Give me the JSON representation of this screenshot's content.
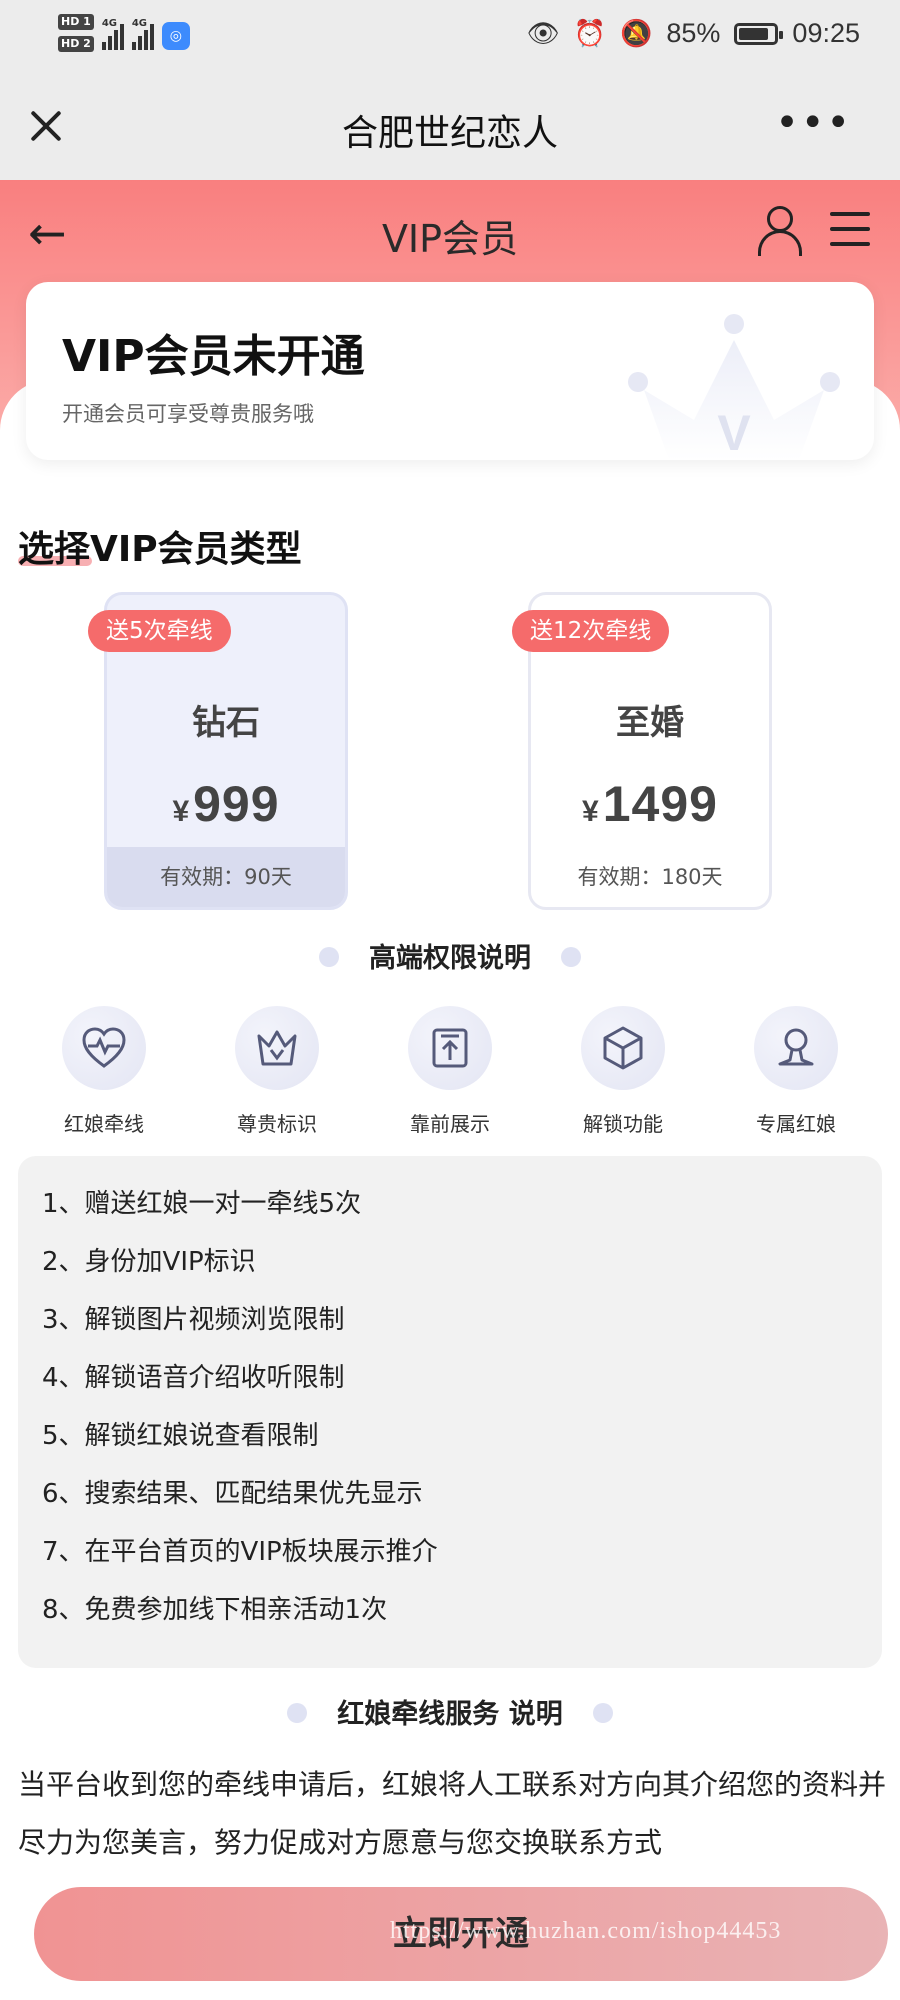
{
  "status_bar": {
    "sim1": "HD 1",
    "sim2": "HD 2",
    "net1": "4G",
    "net2": "4G",
    "battery": "85%",
    "battery_level": 0.85,
    "time": "09:25"
  },
  "app_bar": {
    "title": "合肥世纪恋人",
    "more": "•••"
  },
  "header": {
    "title": "VIP会员"
  },
  "vip_status": {
    "title": "VIP会员未开通",
    "subtitle": "开通会员可享受尊贵服务哦",
    "crown_letter": "V"
  },
  "section": {
    "title": "选择VIP会员类型"
  },
  "plans": [
    {
      "badge": "送5次牵线",
      "name": "钻石",
      "currency": "¥",
      "price": "999",
      "validity": "有效期：90天",
      "selected": true
    },
    {
      "badge": "送12次牵线",
      "name": "至婚",
      "currency": "¥",
      "price": "1499",
      "validity": "有效期：180天",
      "selected": false
    }
  ],
  "rights": {
    "title": "高端权限说明",
    "items": [
      {
        "label": "红娘牵线",
        "icon": "heart-pulse-icon"
      },
      {
        "label": "尊贵标识",
        "icon": "crown-icon"
      },
      {
        "label": "靠前展示",
        "icon": "pin-top-icon"
      },
      {
        "label": "解锁功能",
        "icon": "cube-icon"
      },
      {
        "label": "专属红娘",
        "icon": "person-icon"
      }
    ]
  },
  "privileges": [
    "1、赠送红娘一对一牵线5次",
    "2、身份加VIP标识",
    "3、解锁图片视频浏览限制",
    "4、解锁语音介绍收听限制",
    "5、解锁红娘说查看限制",
    "6、搜索结果、匹配结果优先显示",
    "7、在平台首页的VIP板块展示推介",
    "8、免费参加线下相亲活动1次"
  ],
  "matchmaker": {
    "title": "红娘牵线服务 说明",
    "text": "当平台收到您的牵线申请后，红娘将人工联系对方向其介绍您的资料并尽力为您美言，努力促成对方愿意与您交换联系方式"
  },
  "cta": {
    "label": "立即开通"
  },
  "watermark": "https://www.huzhan.com/ishop44453",
  "colors": {
    "accent": "#f97f7f",
    "badge": "#f56b6b",
    "button": "#f09393"
  }
}
